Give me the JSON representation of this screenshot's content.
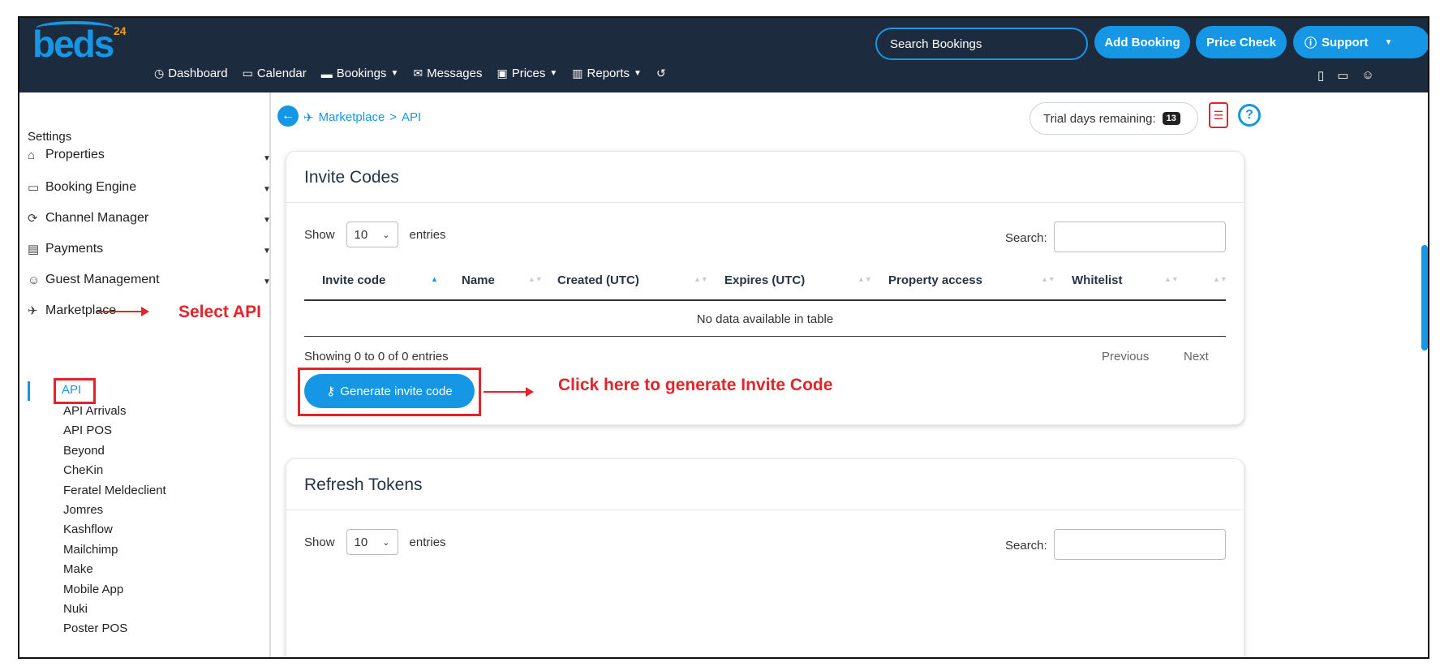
{
  "header": {
    "logo_text": "beds",
    "logo_number": "24",
    "nav": [
      {
        "icon": "dashboard-icon",
        "glyph": "◷",
        "label": "Dashboard",
        "caret": false
      },
      {
        "icon": "calendar-icon",
        "glyph": "▭",
        "label": "Calendar",
        "caret": false
      },
      {
        "icon": "bed-icon",
        "glyph": "▬",
        "label": "Bookings",
        "caret": true
      },
      {
        "icon": "messages-icon",
        "glyph": "✉",
        "label": "Messages",
        "caret": false
      },
      {
        "icon": "prices-icon",
        "glyph": "▣",
        "label": "Prices",
        "caret": true
      },
      {
        "icon": "reports-icon",
        "glyph": "▥",
        "label": "Reports",
        "caret": true
      },
      {
        "icon": "history-icon",
        "glyph": "↺",
        "label": "",
        "caret": false
      }
    ],
    "search_placeholder": "Search Bookings",
    "add_booking": "Add Booking",
    "price_check": "Price Check",
    "support": "Support"
  },
  "sidebar": {
    "settings_label": "Settings",
    "menus": [
      {
        "icon": "home-icon",
        "glyph": "⌂",
        "label": "Properties"
      },
      {
        "icon": "monitor-icon",
        "glyph": "▭",
        "label": "Booking Engine"
      },
      {
        "icon": "sync-icon",
        "glyph": "⟳",
        "label": "Channel Manager"
      },
      {
        "icon": "card-icon",
        "glyph": "▤",
        "label": "Payments"
      },
      {
        "icon": "users-icon",
        "glyph": "☺",
        "label": "Guest Management"
      },
      {
        "icon": "rocket-icon",
        "glyph": "✈",
        "label": "Marketplace"
      }
    ],
    "submenu": [
      "API",
      "API Arrivals",
      "API POS",
      "Beyond",
      "CheKin",
      "Feratel Meldeclient",
      "Jomres",
      "Kashflow",
      "Mailchimp",
      "Make",
      "Mobile App",
      "Nuki",
      "Poster POS"
    ]
  },
  "annotations": {
    "select_api": "Select API",
    "click_generate": "Click here to generate Invite Code"
  },
  "breadcrumb": {
    "marketplace": "Marketplace",
    "separator": ">",
    "api": "API"
  },
  "trial": {
    "label": "Trial days remaining:",
    "days": "13"
  },
  "invite_codes": {
    "title": "Invite Codes",
    "show_label": "Show",
    "entries_value": "10",
    "entries_label": "entries",
    "search_label": "Search:",
    "columns": [
      "Invite code",
      "Name",
      "Created (UTC)",
      "Expires (UTC)",
      "Property access",
      "Whitelist"
    ],
    "empty_message": "No data available in table",
    "showing": "Showing 0 to 0 of 0 entries",
    "previous": "Previous",
    "next": "Next",
    "generate_button": "Generate invite code"
  },
  "refresh_tokens": {
    "title": "Refresh Tokens",
    "show_label": "Show",
    "entries_value": "10",
    "entries_label": "entries",
    "search_label": "Search:"
  },
  "colors": {
    "header_bg": "#1d2b3f",
    "accent": "#1597e5",
    "annotation": "#e3242b"
  }
}
